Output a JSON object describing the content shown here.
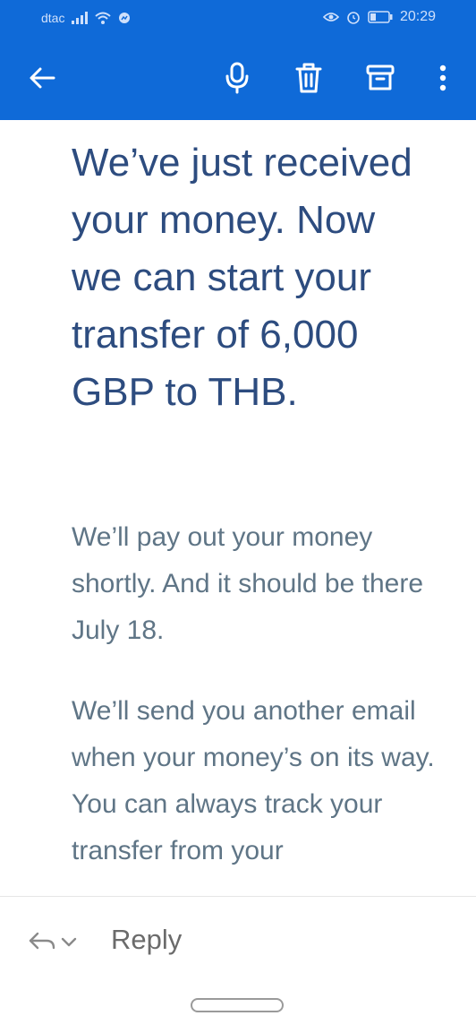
{
  "status_bar": {
    "carrier": "dtac",
    "time": "20:29"
  },
  "app_bar": {
    "icons": [
      "back-arrow-icon",
      "microphone-icon",
      "trash-icon",
      "archive-icon",
      "more-vertical-icon"
    ]
  },
  "email": {
    "headline": "We’ve just received your money. Now we can start your transfer of 6,000 GBP to THB.",
    "paragraph_1": "We’ll pay out your money shortly. And it should be there July 18.",
    "paragraph_2": "We’ll send you another email when your money’s on its way. You can always track your transfer from your"
  },
  "reply_bar": {
    "reply_label": "Reply"
  },
  "colors": {
    "primary": "#0f6ad8",
    "headline": "#2d4c7f",
    "body_text": "#5f7586"
  }
}
